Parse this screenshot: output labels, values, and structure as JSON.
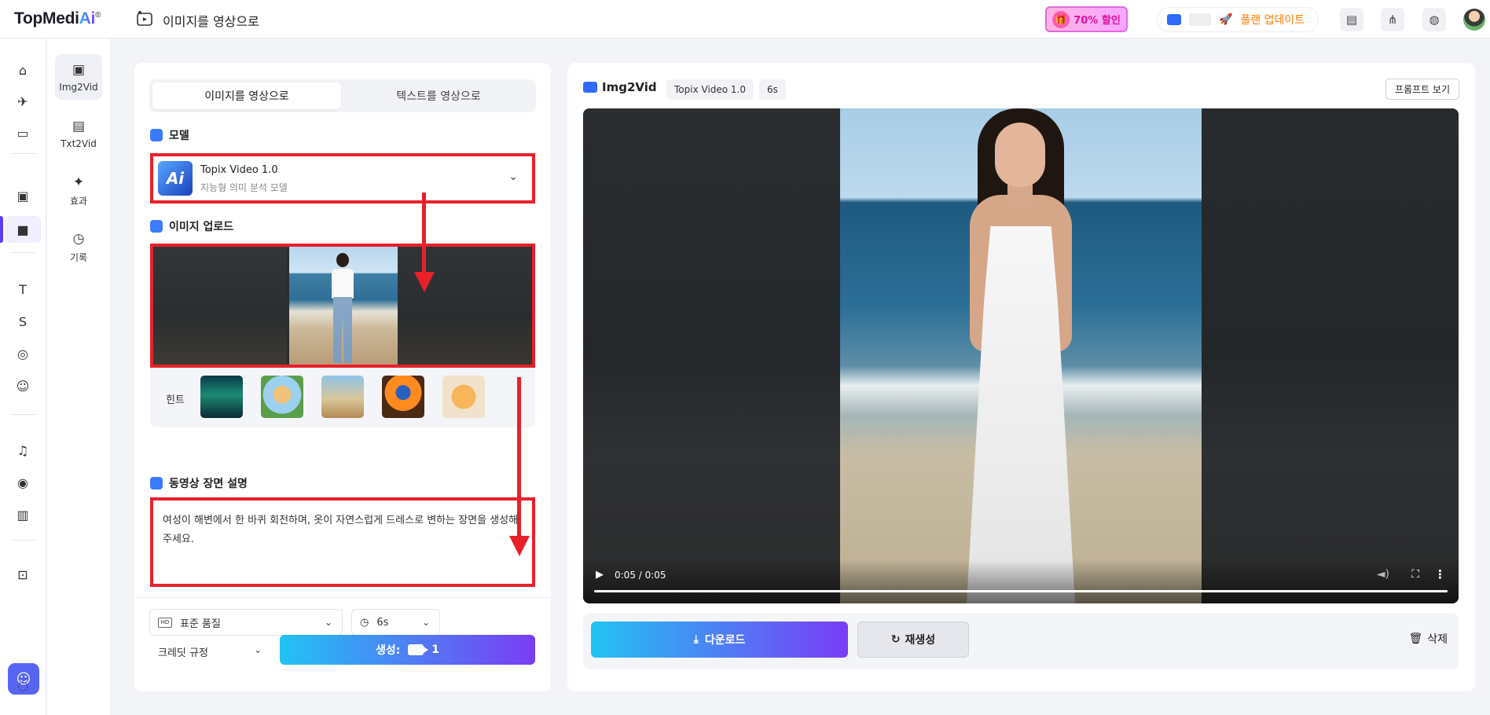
{
  "app": {
    "logo_main": "TopMedi",
    "logo_ai": "Ai",
    "logo_reg": "®",
    "page_title": "이미지를 영상으로",
    "promo_label": "70% 할인",
    "upgrade_label": "플랜 업데이트",
    "accent_gradient": [
      "#22c3f4",
      "#7a3cf5"
    ],
    "highlight_color": "#e8202a"
  },
  "subnav": [
    {
      "label": "Img2Vid",
      "icon": "image-to-video-icon"
    },
    {
      "label": "Txt2Vid",
      "icon": "text-to-video-icon"
    },
    {
      "label": "효과",
      "icon": "magic-wand-icon"
    },
    {
      "label": "기록",
      "icon": "clock-icon"
    }
  ],
  "left": {
    "tabs": [
      "이미지를 영상으로",
      "텍스트를 영상으로"
    ],
    "model_label": "모델",
    "model_name": "Topix Video 1.0",
    "model_desc": "지능형 의미 분석 모델",
    "upload_label": "이미지 업로드",
    "hint_label": "힌트",
    "desc_label": "동영상 장면 설명",
    "desc_text": "여성이 해변에서 한 바퀴 회전하며, 옷이 자연스럽게 드레스로 변하는 장면을 생성해주세요.",
    "quality": "표준 품질",
    "duration": "6s",
    "credit_rule": "크레딧 규정",
    "generate_label": "생성:",
    "generate_cost": "1"
  },
  "right": {
    "brand": "Img2Vid",
    "chip_model": "Topix Video 1.0",
    "chip_duration": "6s",
    "prompt_button": "프롬프트 보기",
    "time_display": "0:05 / 0:05",
    "progress": 1.0,
    "download": "다운로드",
    "regenerate": "재생성",
    "delete": "삭제"
  }
}
